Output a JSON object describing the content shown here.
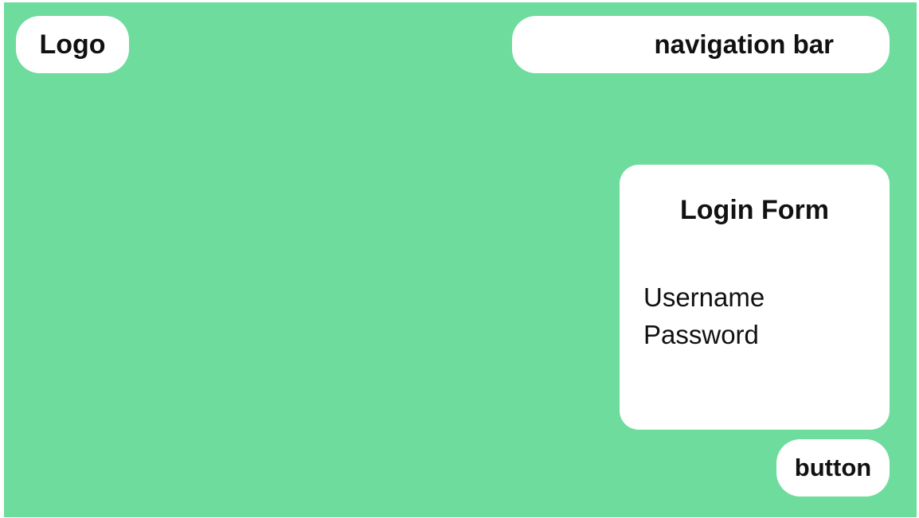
{
  "colors": {
    "background": "#6ddc9c",
    "box": "#ffffff",
    "text": "#111111"
  },
  "logo": {
    "label": "Logo"
  },
  "navigation": {
    "label": "navigation bar"
  },
  "login_form": {
    "title": "Login Form",
    "fields": [
      "Username",
      "Password"
    ]
  },
  "button": {
    "label": "button"
  }
}
